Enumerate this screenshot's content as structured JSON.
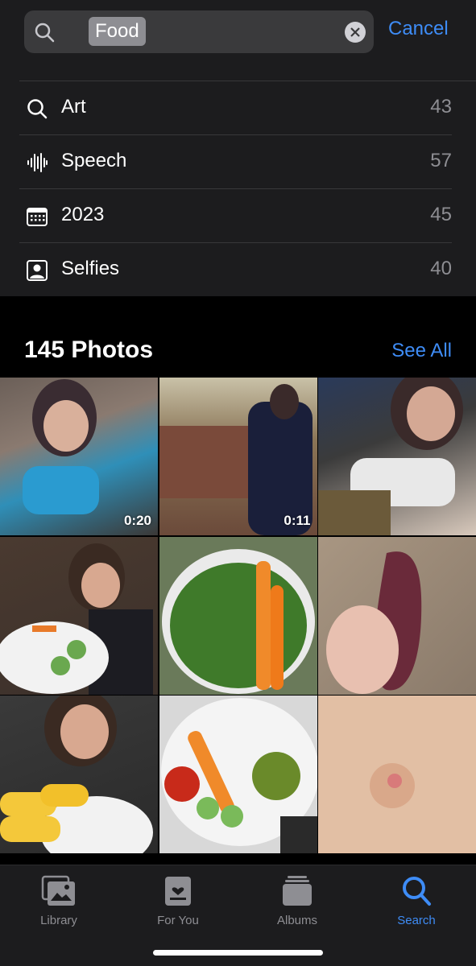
{
  "search": {
    "token": "Food",
    "cancel_label": "Cancel"
  },
  "suggestions": [
    {
      "icon": "magnifier-icon",
      "label": "Art",
      "count": "43"
    },
    {
      "icon": "waveform-icon",
      "label": "Speech",
      "count": "57"
    },
    {
      "icon": "calendar-icon",
      "label": "2023",
      "count": "45"
    },
    {
      "icon": "person-icon",
      "label": "Selfies",
      "count": "40"
    }
  ],
  "photos": {
    "title": "145 Photos",
    "see_all_label": "See All",
    "items": [
      {
        "duration": "0:20"
      },
      {
        "duration": "0:11"
      },
      {},
      {},
      {},
      {},
      {},
      {},
      {}
    ]
  },
  "tabs": [
    {
      "label": "Library",
      "icon": "library-icon",
      "active": false
    },
    {
      "label": "For You",
      "icon": "for-you-icon",
      "active": false
    },
    {
      "label": "Albums",
      "icon": "albums-icon",
      "active": false
    },
    {
      "label": "Search",
      "icon": "search-icon",
      "active": true
    }
  ],
  "colors": {
    "accent": "#3e8cf6",
    "background": "#000000",
    "panel": "#1c1c1e"
  }
}
